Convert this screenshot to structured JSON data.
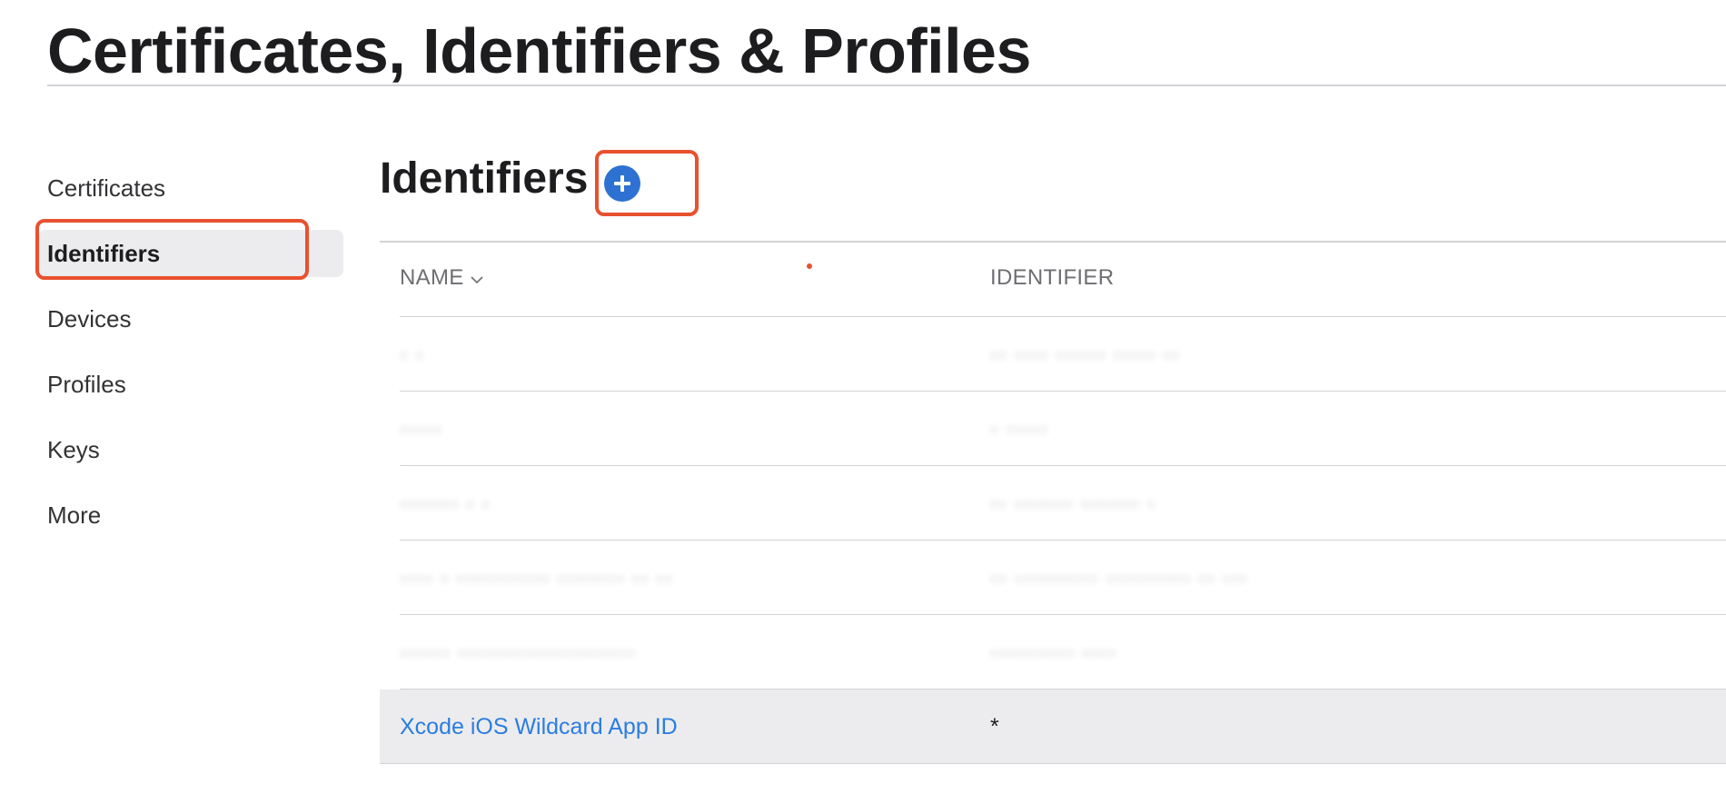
{
  "page": {
    "title": "Certificates, Identifiers & Profiles"
  },
  "sidebar": {
    "items": [
      {
        "label": "Certificates",
        "active": false
      },
      {
        "label": "Identifiers",
        "active": true
      },
      {
        "label": "Devices",
        "active": false
      },
      {
        "label": "Profiles",
        "active": false
      },
      {
        "label": "Keys",
        "active": false
      },
      {
        "label": "More",
        "active": false
      }
    ]
  },
  "main": {
    "section_title": "Identifiers",
    "add_button_icon": "plus-circle-icon",
    "table": {
      "columns": {
        "name": "NAME",
        "identifier": "IDENTIFIER"
      },
      "sort_icon": "chevron-down-icon",
      "rows": [
        {
          "name": "· ·",
          "identifier": "·· ···· ······ ····· ··",
          "redacted": true
        },
        {
          "name": "·····",
          "identifier": "· ·····",
          "redacted": true
        },
        {
          "name": "······· · ·",
          "identifier": "·· ······· ······· ·",
          "redacted": true
        },
        {
          "name": "···· · ··········· ········ ·· ··",
          "identifier": "·· ·········· ·········· ·· ···",
          "redacted": true
        },
        {
          "name": "······ ·····················",
          "identifier": "·········· ····",
          "redacted": true
        },
        {
          "name": "Xcode iOS Wildcard App ID",
          "identifier": "*",
          "redacted": false
        }
      ]
    }
  },
  "annotations": {
    "highlight_color": "#e8512f"
  },
  "colors": {
    "link": "#2b7de0",
    "accent": "#2d72d2",
    "row_highlight": "#ececee"
  }
}
